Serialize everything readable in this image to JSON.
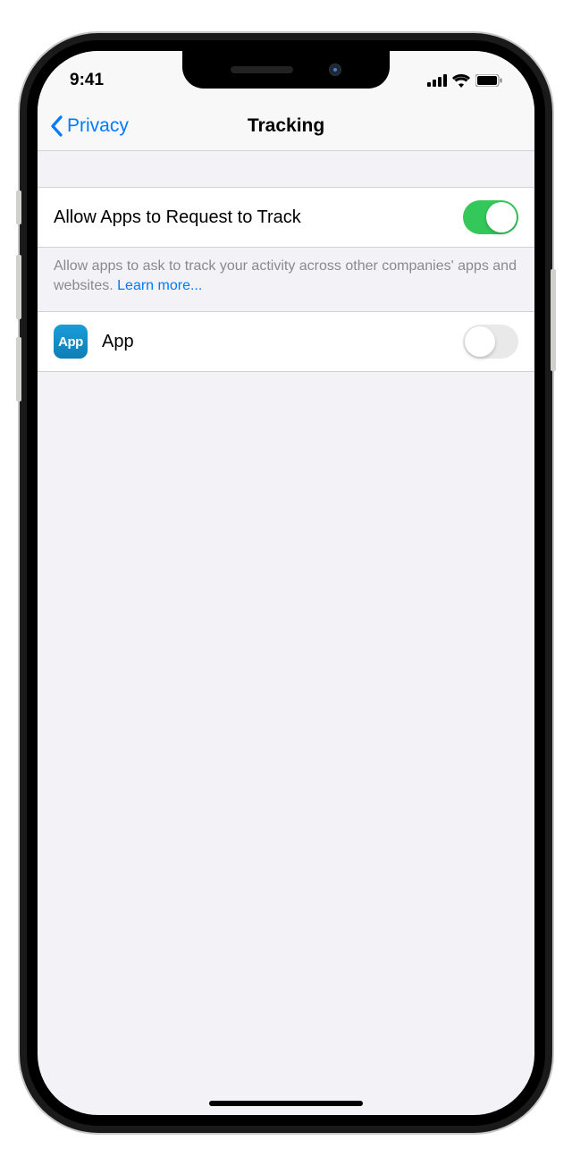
{
  "status": {
    "time": "9:41"
  },
  "nav": {
    "back_label": "Privacy",
    "title": "Tracking"
  },
  "settings": {
    "allow_tracking": {
      "label": "Allow Apps to Request to Track",
      "enabled": true
    },
    "footer": {
      "text": "Allow apps to ask to track your activity across other companies' apps and websites. ",
      "link": "Learn more..."
    },
    "apps": [
      {
        "name": "App",
        "icon_label": "App",
        "enabled": false
      }
    ]
  }
}
